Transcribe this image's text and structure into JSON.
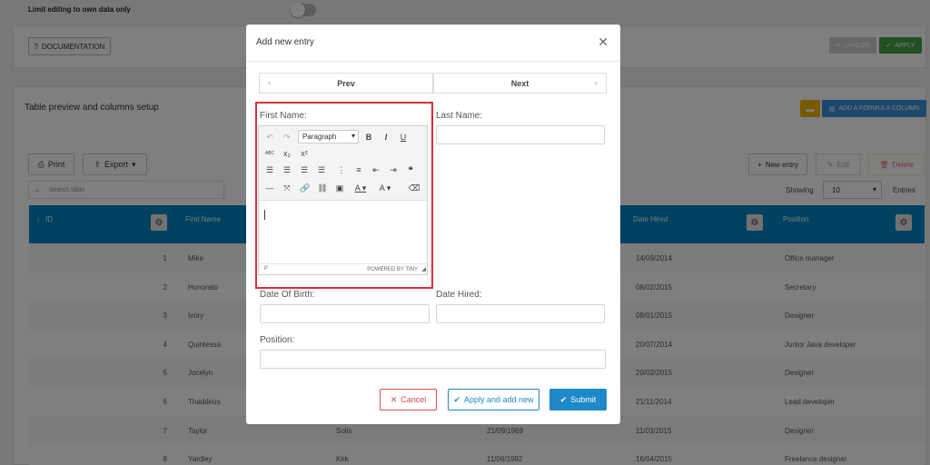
{
  "settings": {
    "limit_label": "Limit editing to own data only",
    "documentation_label": "DOCUMENTATION",
    "cancel_label": "CANCEL",
    "apply_label": "APPLY"
  },
  "table_section": {
    "title": "Table preview and columns setup",
    "formula_label": "ADD A FORMULA COLUMN",
    "print_label": "Print",
    "export_label": "Export",
    "new_entry_label": "New entry",
    "edit_label": "Edit",
    "delete_label": "Delete",
    "search_placeholder": "Search table",
    "showing_label": "Showing",
    "showing_value": "10",
    "entries_label": "Entries"
  },
  "columns": {
    "id": "ID",
    "first_name": "First Name",
    "date_hired": "Date Hired",
    "position": "Position"
  },
  "rows": [
    {
      "id": "1",
      "first": "Mike",
      "last": "",
      "dob": "",
      "hired": "14/09/2014",
      "position": "Office manager"
    },
    {
      "id": "2",
      "first": "Honorato",
      "last": "",
      "dob": "",
      "hired": "08/02/2015",
      "position": "Secretary"
    },
    {
      "id": "3",
      "first": "Ivory",
      "last": "",
      "dob": "",
      "hired": "08/01/2015",
      "position": "Designer"
    },
    {
      "id": "4",
      "first": "Quintessa",
      "last": "",
      "dob": "",
      "hired": "20/07/2014",
      "position": "Junior Java developer"
    },
    {
      "id": "5",
      "first": "Jocelyn",
      "last": "",
      "dob": "",
      "hired": "20/02/2015",
      "position": "Designer"
    },
    {
      "id": "6",
      "first": "Thaddeus",
      "last": "",
      "dob": "",
      "hired": "21/11/2014",
      "position": "Lead developer"
    },
    {
      "id": "7",
      "first": "Taylor",
      "last": "Solis",
      "dob": "21/09/1969",
      "hired": "11/03/2015",
      "position": "Designer"
    },
    {
      "id": "8",
      "first": "Yardley",
      "last": "Kirk",
      "dob": "11/06/1992",
      "hired": "16/04/2015",
      "position": "Freelance designer"
    }
  ],
  "modal": {
    "title": "Add new entry",
    "prev_label": "Prev",
    "next_label": "Next",
    "first_name_label": "First Name:",
    "last_name_label": "Last Name:",
    "dob_label": "Date Of Birth:",
    "date_hired_label": "Date Hired:",
    "position_label": "Position:",
    "cancel_label": "Cancel",
    "apply_new_label": "Apply and add new",
    "submit_label": "Submit"
  },
  "editor": {
    "format_label": "Paragraph",
    "status_path": "P",
    "powered_label": "POWERED BY TINY",
    "bold": "B",
    "italic": "I",
    "underline": "U",
    "spellcheck": "ABC",
    "quote": "❝"
  },
  "icons": {
    "gear": "gear-icon",
    "close": "close-icon",
    "check": "check-icon",
    "x": "x-icon"
  },
  "colors": {
    "header_blue": "#0084be",
    "apply_green": "#43a047",
    "submit_blue": "#1e88c8",
    "cancel_red": "#e04848",
    "formula_blue": "#3a8fd8",
    "yellow": "#f2b500",
    "highlight_red": "#d9303a"
  }
}
